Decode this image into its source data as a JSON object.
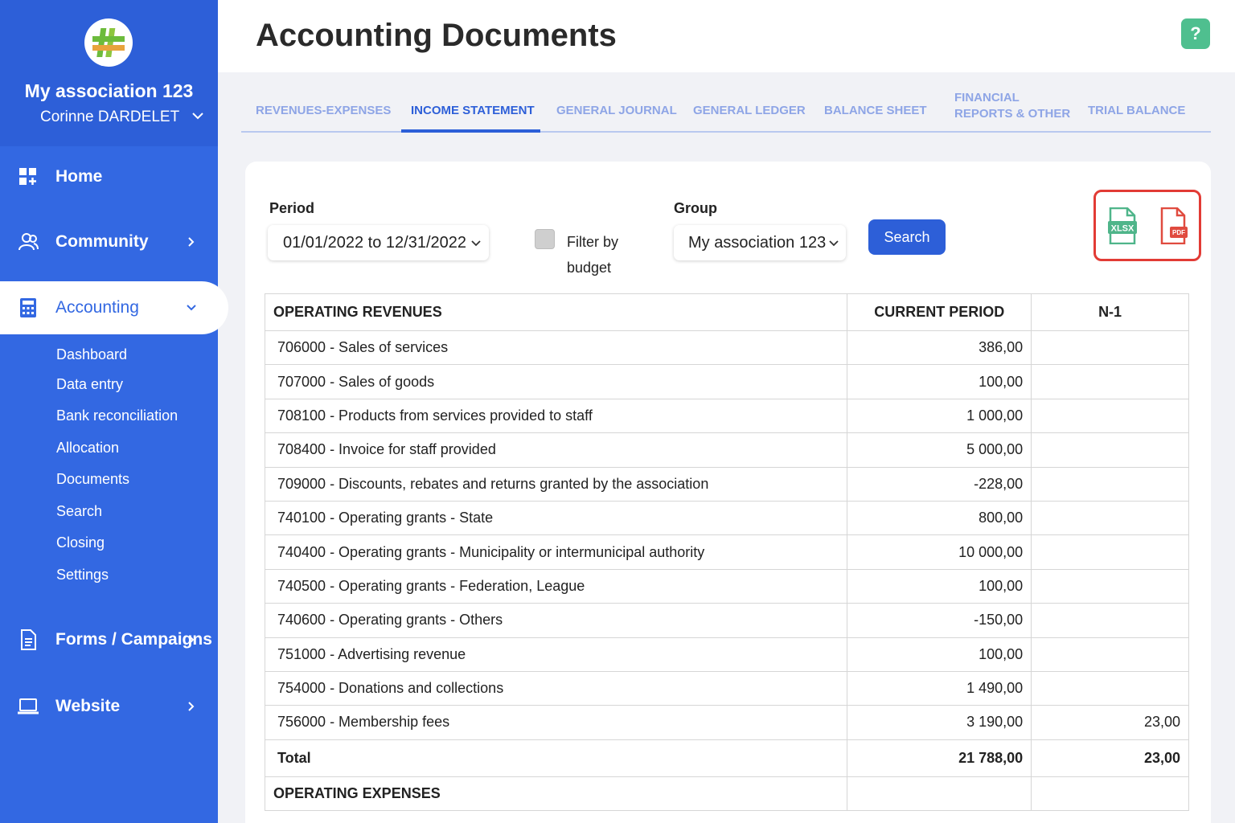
{
  "sidebar": {
    "assoc_name": "My association 123",
    "user_name": "Corinne DARDELET",
    "nav": {
      "home": "Home",
      "community": "Community",
      "accounting": "Accounting",
      "forms": "Forms / Campaigns",
      "website": "Website"
    },
    "accounting_sub": [
      "Dashboard",
      "Data entry",
      "Bank reconciliation",
      "Allocation",
      "Documents",
      "Search",
      "Closing",
      "Settings"
    ]
  },
  "header": {
    "title": "Accounting Documents",
    "help": "?"
  },
  "tabs": [
    {
      "label": "REVENUES-EXPENSES"
    },
    {
      "label": "INCOME STATEMENT"
    },
    {
      "label": "GENERAL JOURNAL"
    },
    {
      "label": "GENERAL LEDGER"
    },
    {
      "label": "BALANCE SHEET"
    },
    {
      "label": "FINANCIAL",
      "label2": "REPORTS & OTHER"
    },
    {
      "label": "TRIAL BALANCE"
    }
  ],
  "filters": {
    "period_label": "Period",
    "period_value": "01/01/2022 to 12/31/2022",
    "filter_budget_label_1": "Filter by",
    "filter_budget_label_2": "budget",
    "filter_budget_checked": false,
    "group_label": "Group",
    "group_value": "My association 123",
    "search_label": "Search"
  },
  "export": {
    "xlsx_icon": "xlsx-file-icon",
    "pdf_icon": "pdf-file-icon",
    "xlsx_text": "XLSX",
    "pdf_text": "PDF"
  },
  "table": {
    "header": {
      "section": "OPERATING REVENUES",
      "current": "CURRENT PERIOD",
      "prev": "N-1"
    },
    "rows": [
      {
        "label": "706000 - Sales of services",
        "current": "386,00",
        "prev": ""
      },
      {
        "label": "707000 - Sales of goods",
        "current": "100,00",
        "prev": ""
      },
      {
        "label": "708100 - Products from services provided to staff",
        "current": "1 000,00",
        "prev": ""
      },
      {
        "label": "708400 - Invoice for staff provided",
        "current": "5 000,00",
        "prev": ""
      },
      {
        "label": "709000 - Discounts, rebates and returns granted by the association",
        "current": "-228,00",
        "prev": ""
      },
      {
        "label": "740100 - Operating grants - State",
        "current": "800,00",
        "prev": ""
      },
      {
        "label": "740400 - Operating grants - Municipality or intermunicipal authority",
        "current": "10 000,00",
        "prev": ""
      },
      {
        "label": "740500 - Operating grants - Federation, League",
        "current": "100,00",
        "prev": ""
      },
      {
        "label": "740600 - Operating grants - Others",
        "current": "-150,00",
        "prev": ""
      },
      {
        "label": "751000 - Advertising revenue",
        "current": "100,00",
        "prev": ""
      },
      {
        "label": "754000 - Donations and collections",
        "current": "1 490,00",
        "prev": ""
      },
      {
        "label": "756000 - Membership fees",
        "current": "3 190,00",
        "prev": "23,00"
      }
    ],
    "total": {
      "label": "Total",
      "current": "21 788,00",
      "prev": "23,00"
    },
    "next_section": "OPERATING EXPENSES"
  }
}
